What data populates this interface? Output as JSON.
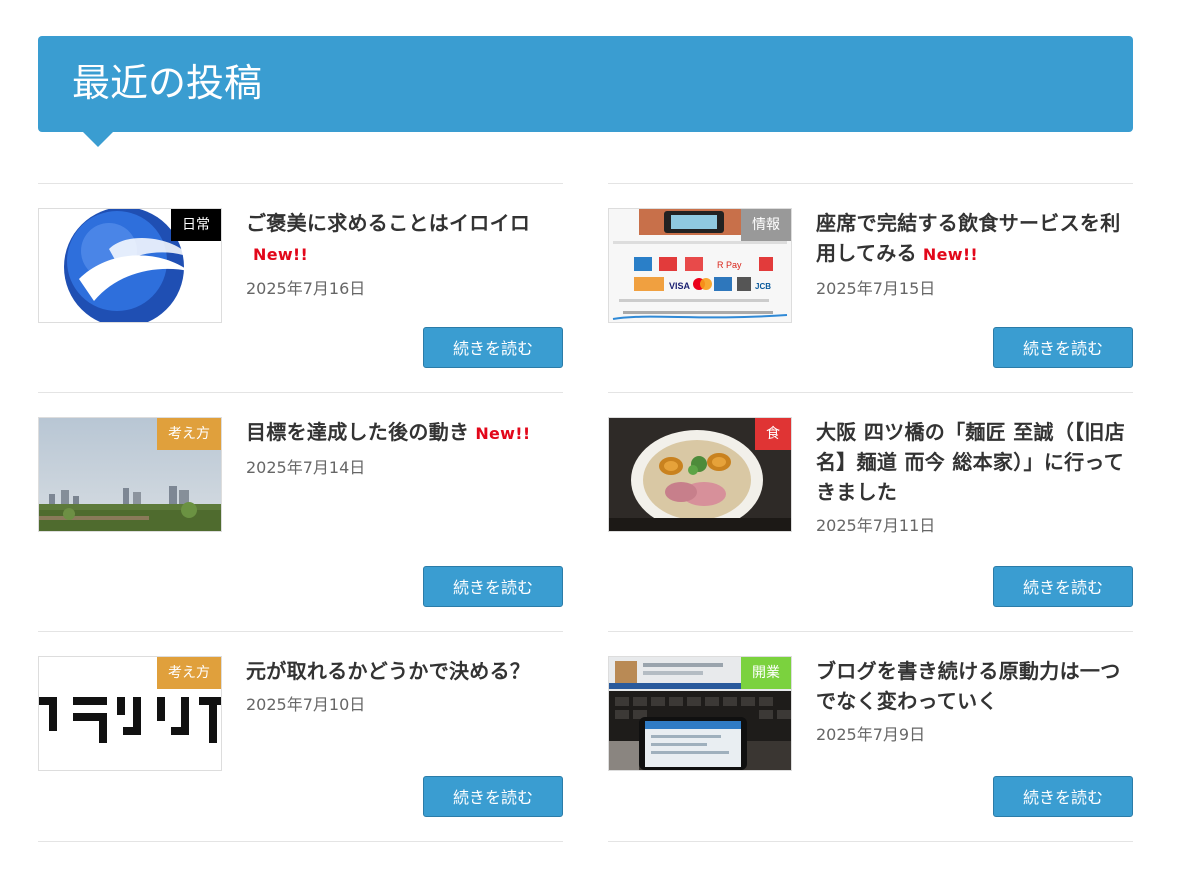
{
  "section": {
    "title": "最近の投稿"
  },
  "posts": [
    {
      "title": "ご褒美に求めることはイロイロ",
      "new_label": "New!!",
      "date": "2025年7月16日",
      "category": "日常",
      "category_color": "#000000",
      "more_label": "続きを読む"
    },
    {
      "title": "座席で完結する飲食サービスを利用してみる",
      "new_label": "New!!",
      "date": "2025年7月15日",
      "category": "情報",
      "category_color": "#999999",
      "more_label": "続きを読む"
    },
    {
      "title": "目標を達成した後の動き",
      "new_label": "New!!",
      "date": "2025年7月14日",
      "category": "考え方",
      "category_color": "#e0a03c",
      "more_label": "続きを読む"
    },
    {
      "title": "大阪 四ツ橋の「麺匠 至誠（【旧店名】麺道 而今 総本家）」に行ってきました",
      "date": "2025年7月11日",
      "category": "食",
      "category_color": "#e03434",
      "more_label": "続きを読む"
    },
    {
      "title": "元が取れるかどうかで決める？",
      "date": "2025年7月10日",
      "category": "考え方",
      "category_color": "#e0a03c",
      "more_label": "続きを読む"
    },
    {
      "title": "ブログを書き続ける原動力は一つでなく変わっていく",
      "date": "2025年7月9日",
      "category": "開業",
      "category_color": "#7bd23e",
      "more_label": "続きを読む"
    }
  ],
  "thumbnails": {
    "post2_payment_labels": [
      "VISA",
      "R Pay",
      "JCB"
    ]
  },
  "colors": {
    "accent": "#3a9dd1",
    "new_badge": "#e2071a"
  }
}
